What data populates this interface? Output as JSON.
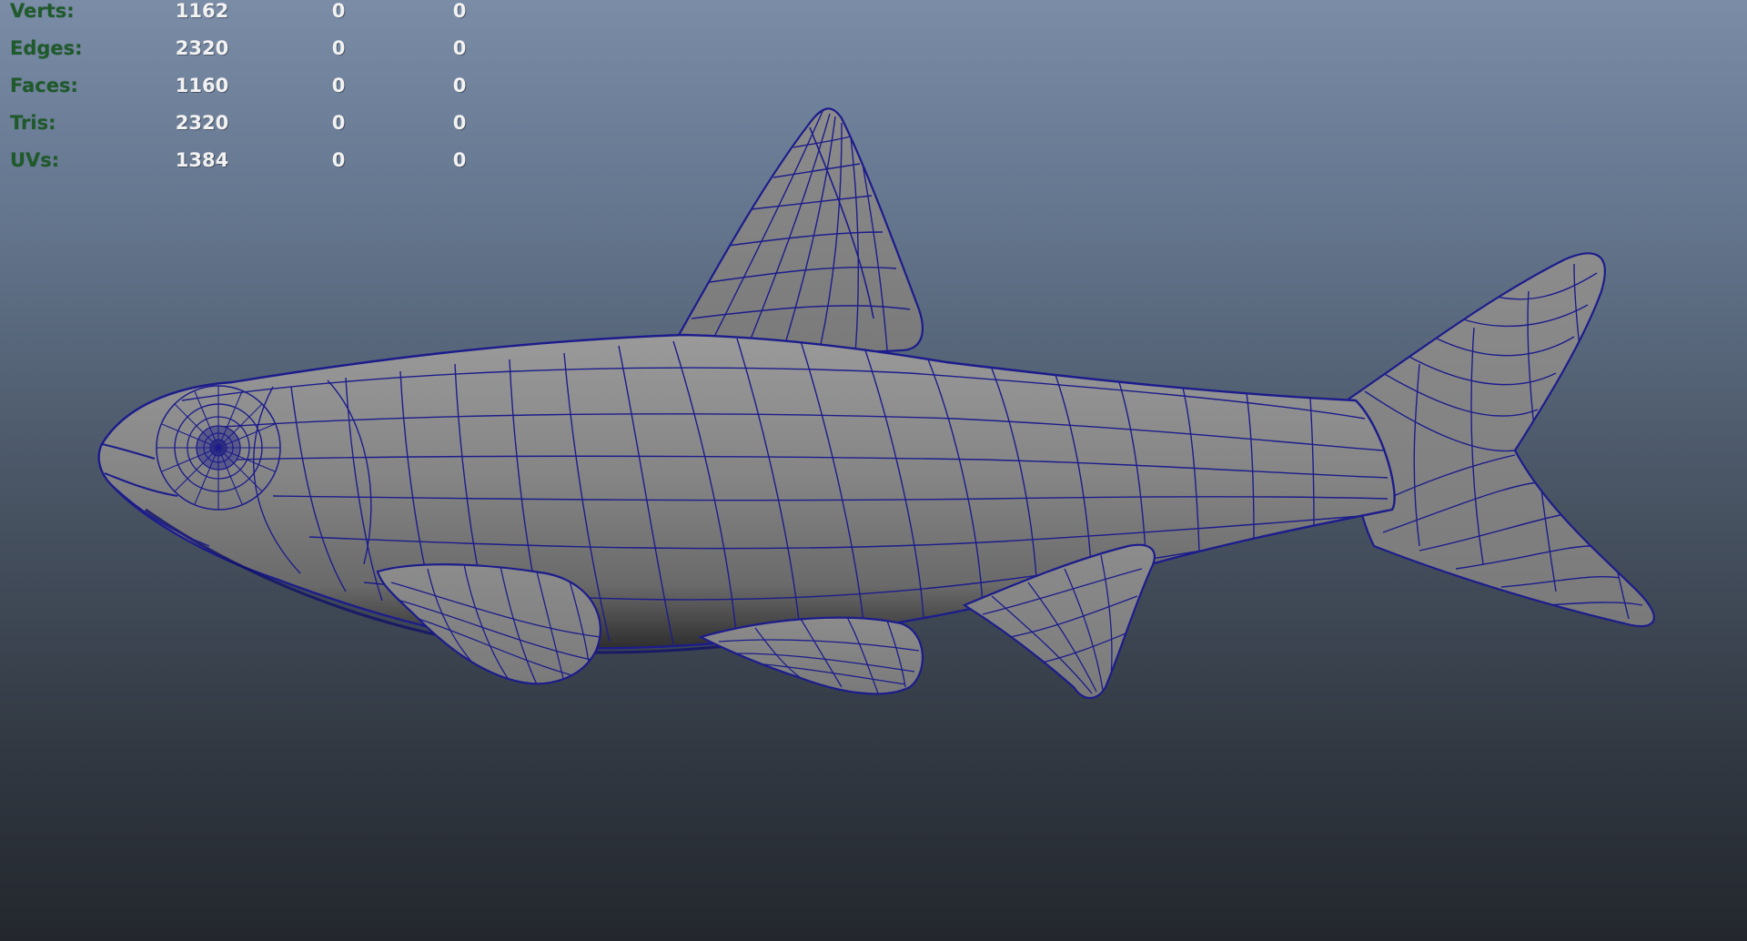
{
  "hud": {
    "rows": [
      {
        "label": "Verts:",
        "values": [
          "1162",
          "0",
          "0"
        ]
      },
      {
        "label": "Edges:",
        "values": [
          "2320",
          "0",
          "0"
        ]
      },
      {
        "label": "Faces:",
        "values": [
          "1160",
          "0",
          "0"
        ]
      },
      {
        "label": "Tris:",
        "values": [
          "2320",
          "0",
          "0"
        ]
      },
      {
        "label": "UVs:",
        "values": [
          "1384",
          "0",
          "0"
        ]
      }
    ]
  },
  "colors": {
    "wireframe": "#1c1c8c",
    "surface": "#808080",
    "label_green": "#1e5a2a"
  },
  "model": {
    "subject": "fish-mesh",
    "display": "wireframe-on-shaded"
  }
}
